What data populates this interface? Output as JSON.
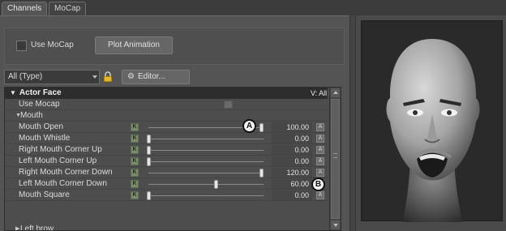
{
  "tabs": [
    {
      "label": "Channels",
      "active": true
    },
    {
      "label": "MoCap",
      "active": false
    }
  ],
  "mocap_panel": {
    "use_mocap_label": "Use MoCap",
    "use_mocap_checked": false,
    "plot_button_label": "Plot Animation"
  },
  "filter": {
    "dropdown_value": "All (Type)",
    "editor_button_label": "Editor...",
    "editor_icon": "gear-icon",
    "lock_icon": "lock-icon"
  },
  "tree": {
    "header": {
      "label": "Actor Face",
      "visibility": "V: All"
    },
    "use_mocap_row": {
      "label": "Use Mocap"
    },
    "group_mouth": {
      "label": "Mouth",
      "expanded": true
    },
    "channels": [
      {
        "label": "Mouth Open",
        "value": "100.00",
        "level": 1.0
      },
      {
        "label": "Mouth Whistle",
        "value": "0.00",
        "level": 0.0
      },
      {
        "label": "Right Mouth Corner Up",
        "value": "0.00",
        "level": 0.0
      },
      {
        "label": "Left Mouth Corner Up",
        "value": "0.00",
        "level": 0.0
      },
      {
        "label": "Right Mouth Corner Down",
        "value": "120.00",
        "level": 1.0
      },
      {
        "label": "Left Mouth Corner Down",
        "value": "60.00",
        "level": 0.6
      },
      {
        "label": "Mouth Square",
        "value": "0.00",
        "level": 0.0
      }
    ],
    "group_left_brow": {
      "label": "Left brow",
      "expanded": false
    },
    "key_button_label": "K",
    "anim_button_label": "A"
  },
  "callouts": {
    "a": "A",
    "b": "B"
  },
  "viewport": {
    "content": "face-model-preview"
  },
  "colors": {
    "header_bg": "#2d2d2d",
    "key_button": "#7b8c6c"
  }
}
